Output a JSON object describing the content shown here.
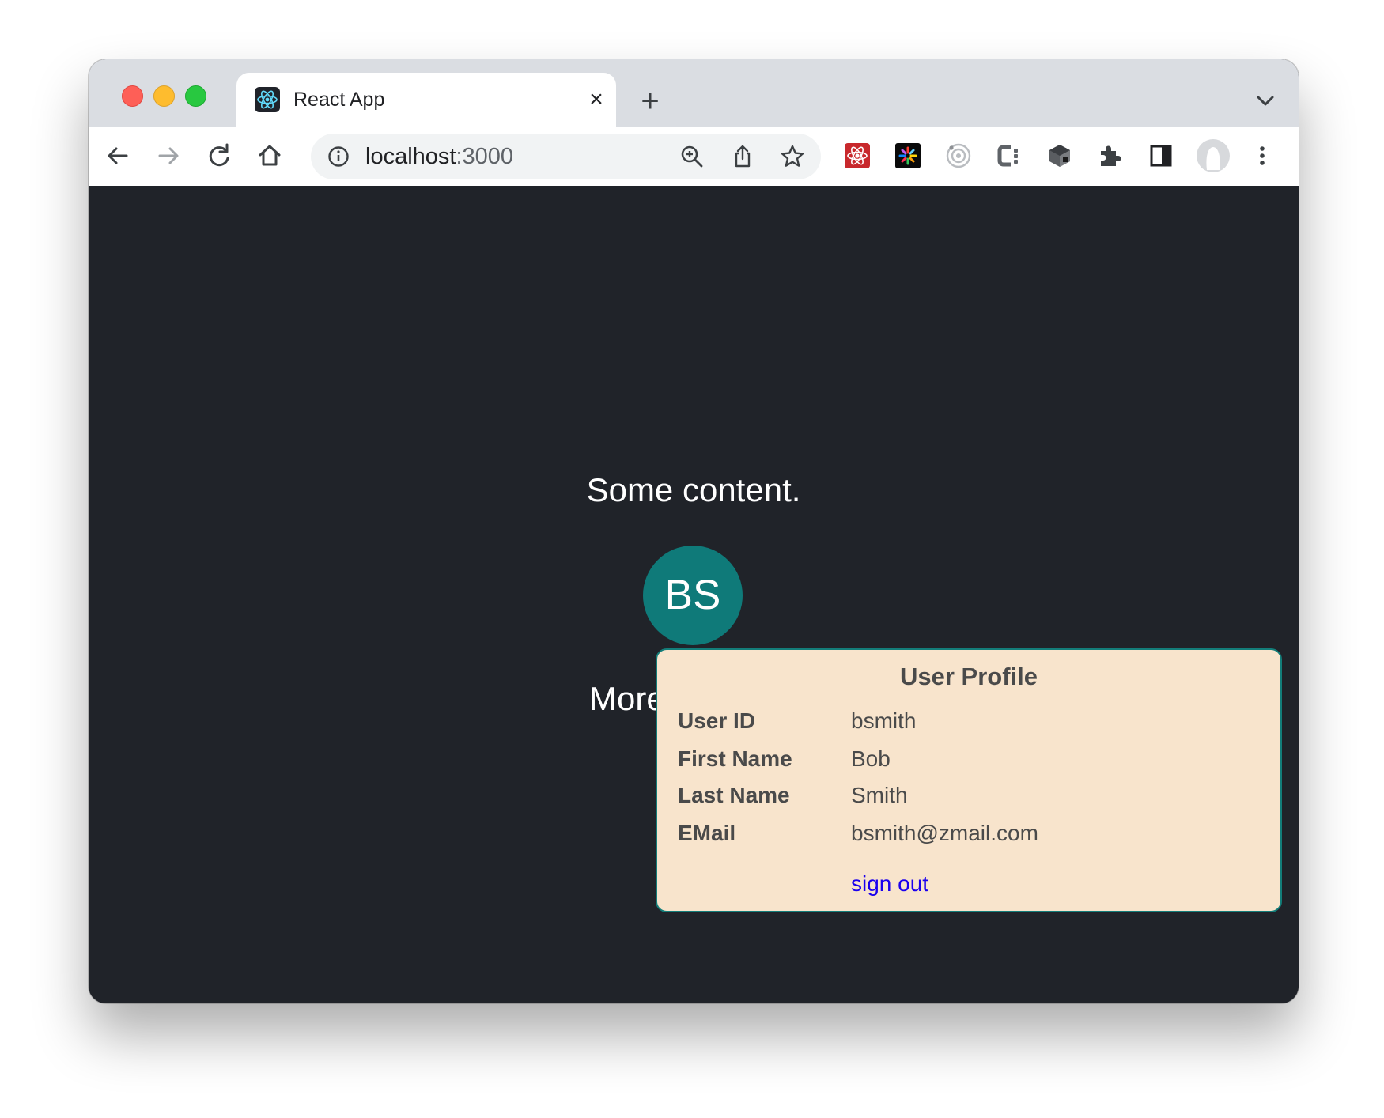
{
  "browser": {
    "tab": {
      "title": "React App",
      "favicon": "react-logo-icon",
      "close": "×"
    },
    "new_tab": "+",
    "address": {
      "host": "localhost",
      "port": ":3000"
    }
  },
  "page": {
    "text_top": "Some content.",
    "avatar_initials": "BS",
    "text_bottom": "More"
  },
  "profile": {
    "title": "User Profile",
    "rows": [
      {
        "label": "User ID",
        "value": "bsmith"
      },
      {
        "label": "First Name",
        "value": "Bob"
      },
      {
        "label": "Last Name",
        "value": "Smith"
      },
      {
        "label": "EMail",
        "value": "bsmith@zmail.com"
      }
    ],
    "signout_label": "sign out"
  },
  "colors": {
    "content_bg": "#202329",
    "avatar_bg": "#0f7a79",
    "popup_bg": "#f8e4cc",
    "popup_border": "#137d79",
    "link": "#1b00ee"
  }
}
